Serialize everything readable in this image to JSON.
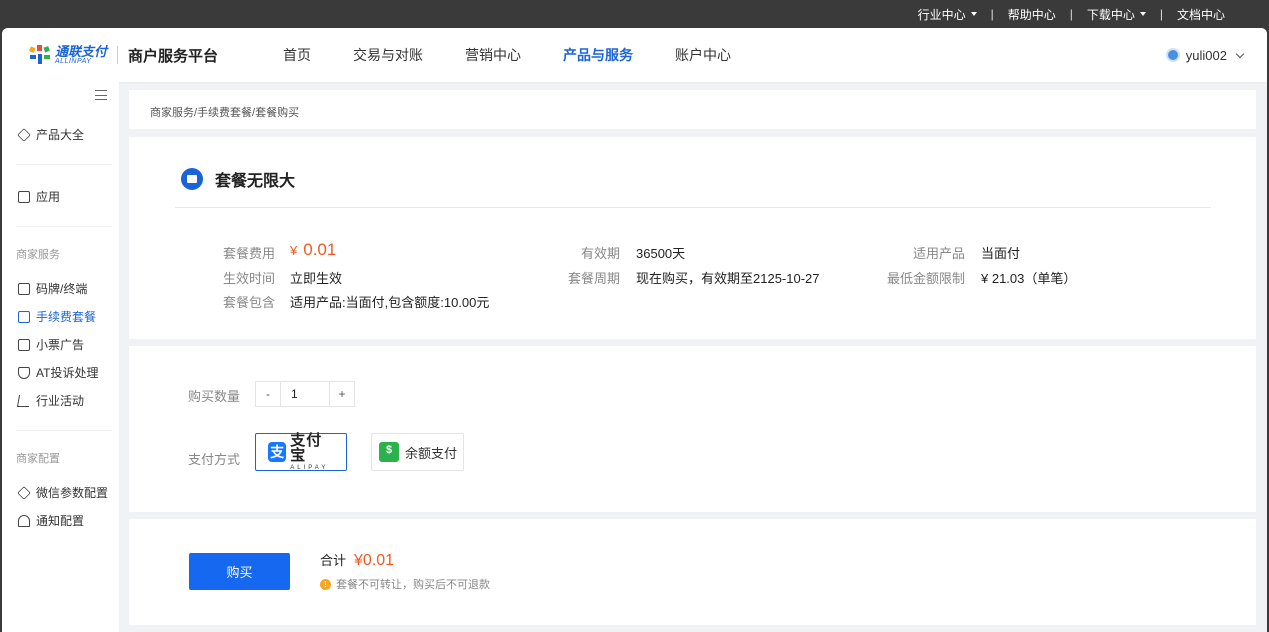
{
  "utilbar": {
    "items": [
      {
        "label": "行业中心",
        "dropdown": true
      },
      {
        "label": "帮助中心",
        "dropdown": false
      },
      {
        "label": "下载中心",
        "dropdown": true
      },
      {
        "label": "文档中心",
        "dropdown": false
      }
    ],
    "separator": "|"
  },
  "header": {
    "logo_cn": "通联支付",
    "logo_en": "ALLINPAY",
    "platform_title": "商户服务平台",
    "nav": [
      "首页",
      "交易与对账",
      "营销中心",
      "产品与服务",
      "账户中心"
    ],
    "active_nav": "产品与服务",
    "username": "yuli002"
  },
  "sidebar": {
    "items_top": [
      {
        "label": "产品大全",
        "icon": "cube-icon"
      },
      {
        "label": "应用",
        "icon": "archive-icon"
      }
    ],
    "group1": "商家服务",
    "group1_items": [
      {
        "label": "码牌/终端",
        "icon": "terminal-icon"
      },
      {
        "label": "手续费套餐",
        "icon": "package-icon"
      },
      {
        "label": "小票广告",
        "icon": "receipt-icon"
      },
      {
        "label": "AT投诉处理",
        "icon": "shield-icon"
      },
      {
        "label": "行业活动",
        "icon": "cart-icon"
      }
    ],
    "group2": "商家配置",
    "group2_items": [
      {
        "label": "微信参数配置",
        "icon": "cube-icon"
      },
      {
        "label": "通知配置",
        "icon": "bell-icon"
      }
    ],
    "active_item": "手续费套餐"
  },
  "breadcrumb": "商家服务/手续费套餐/套餐购买",
  "package": {
    "title": "套餐无限大",
    "fee_label": "套餐费用",
    "fee_symbol": "¥",
    "fee_value": "0.01",
    "effective_label": "生效时间",
    "effective_value": "立即生效",
    "includes_label": "套餐包含",
    "includes_value": "适用产品:当面付,包含额度:10.00元",
    "validity_label": "有效期",
    "validity_value": "36500天",
    "cycle_label": "套餐周期",
    "cycle_value": "现在购买，有效期至2125-10-27",
    "product_label": "适用产品",
    "product_value": "当面付",
    "min_label": "最低金额限制",
    "min_value": "¥ 21.03（单笔）"
  },
  "purchase": {
    "qty_label": "购买数量",
    "qty_minus": "-",
    "qty_value": "1",
    "qty_plus": "+",
    "pay_label": "支付方式",
    "alipay_cn": "支付宝",
    "alipay_en": "ALIPAY",
    "balance_label": "余额支付"
  },
  "checkout": {
    "buy_label": "购买",
    "total_label": "合计",
    "total_amount": "¥0.01",
    "notice": "套餐不可转让，购买后不可退款"
  },
  "colors": {
    "accent": "#1b64d8",
    "button": "#1668f0",
    "price": "#f05a22",
    "warning": "#f5a623"
  }
}
